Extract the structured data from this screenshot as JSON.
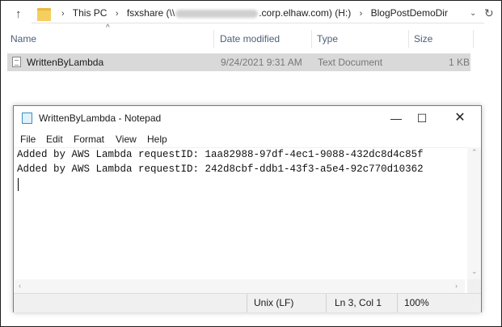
{
  "explorer": {
    "address": {
      "crumbs": [
        "This PC",
        "fsxshare (\\\\",
        ".corp.elhaw.com) (H:)",
        "BlogPostDemoDir"
      ]
    },
    "columns": {
      "name": "Name",
      "date_modified": "Date modified",
      "type": "Type",
      "size": "Size"
    },
    "files": [
      {
        "name": "WrittenByLambda",
        "date_modified": "9/24/2021 9:31 AM",
        "type": "Text Document",
        "size": "1 KB"
      }
    ]
  },
  "notepad": {
    "title": "WrittenByLambda - Notepad",
    "menu": [
      "File",
      "Edit",
      "Format",
      "View",
      "Help"
    ],
    "lines": [
      "Added by AWS Lambda requestID: 1aa82988-97df-4ec1-9088-432dc8d4c85f",
      "Added by AWS Lambda requestID: 242d8cbf-ddb1-43f3-a5e4-92c770d10362"
    ],
    "status": {
      "line_ending": "Unix (LF)",
      "position": "Ln 3, Col 1",
      "zoom": "100%"
    }
  }
}
